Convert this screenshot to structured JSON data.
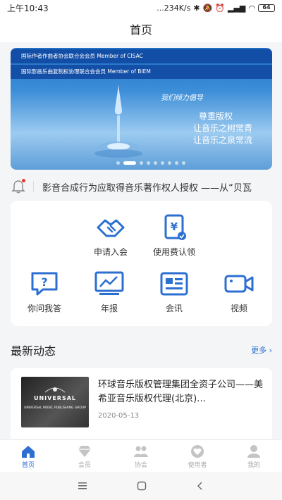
{
  "status_bar": {
    "time": "上午10:43",
    "network_speed": "...234K/s",
    "battery_level": "64"
  },
  "page_title": "首页",
  "banner": {
    "line1": "国际作者作曲者协会联合会会员 Member of CISAC",
    "line2": "国际影画乐曲复制权协理联合会会员 Member of BIEM",
    "intro": "我们倾力倡导",
    "slogans": [
      "尊重版权",
      "让音乐之树常青",
      "让音乐之泉常流"
    ],
    "slide_count": 9,
    "active_slide": 1
  },
  "notice": {
    "text": "影音合成行为应取得音乐著作权人授权 ——从“贝瓦"
  },
  "grid": [
    {
      "label": "申请入会",
      "icon": "handshake-icon"
    },
    {
      "label": "使用费认领",
      "icon": "fee-claim-icon"
    },
    {
      "label": "你问我答",
      "icon": "question-bubble-icon"
    },
    {
      "label": "年报",
      "icon": "chart-board-icon"
    },
    {
      "label": "会讯",
      "icon": "newsletter-icon"
    },
    {
      "label": "视频",
      "icon": "video-camera-icon"
    }
  ],
  "section": {
    "title": "最新动态",
    "more": "更多 ›"
  },
  "news": [
    {
      "title": "环球音乐版权管理集团全资子公司——美希亚音乐版权代理(北京)…",
      "date": "2020-05-13",
      "thumb_logo": "UNIVERSAL",
      "thumb_sub": "UNIVERSAL MUSIC PUBLISHING GROUP"
    }
  ],
  "tabs": [
    {
      "label": "首页",
      "active": true
    },
    {
      "label": "会员",
      "active": false
    },
    {
      "label": "协会",
      "active": false
    },
    {
      "label": "使用者",
      "active": false
    },
    {
      "label": "我的",
      "active": false
    }
  ],
  "colors": {
    "accent": "#2c6fd1",
    "inactive": "#b8b8b8"
  }
}
